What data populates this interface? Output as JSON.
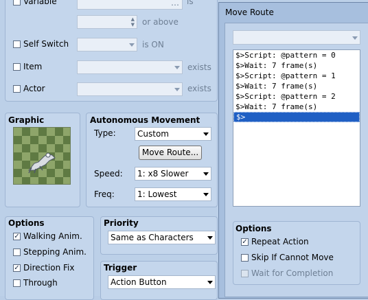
{
  "conditions": {
    "variable_label": "Variable",
    "variable_value": "",
    "variable_suffix": "is",
    "or_above_value": "",
    "or_above_label": "or above",
    "self_switch_label": "Self Switch",
    "self_switch_value": "",
    "self_switch_suffix": "is ON",
    "item_label": "Item",
    "item_value": "",
    "item_suffix": "exists",
    "actor_label": "Actor",
    "actor_value": "",
    "actor_suffix": "exists"
  },
  "graphic": {
    "title": "Graphic"
  },
  "movement": {
    "title": "Autonomous Movement",
    "type_label": "Type:",
    "type_value": "Custom",
    "move_route_button": "Move Route...",
    "speed_label": "Speed:",
    "speed_value": "1: x8 Slower",
    "freq_label": "Freq:",
    "freq_value": "1: Lowest"
  },
  "options": {
    "title": "Options",
    "walking_anim": "Walking Anim.",
    "walking_checked": true,
    "stepping_anim": "Stepping Anim.",
    "stepping_checked": false,
    "direction_fix": "Direction Fix",
    "direction_checked": true,
    "through": "Through",
    "through_checked": false
  },
  "priority": {
    "title": "Priority",
    "value": "Same as Characters"
  },
  "trigger": {
    "title": "Trigger",
    "value": "Action Button"
  },
  "move_route": {
    "title": "Move Route",
    "target_value": "",
    "commands": [
      "$>Script: @pattern = 0",
      "$>Wait: 7 frame(s)",
      "$>Script: @pattern = 1",
      "$>Wait: 7 frame(s)",
      "$>Script: @pattern = 2",
      "$>Wait: 7 frame(s)",
      "$>"
    ],
    "selected_index": 6,
    "options_title": "Options",
    "repeat_action": "Repeat Action",
    "repeat_checked": true,
    "skip_if_cannot_move": "Skip If Cannot Move",
    "skip_checked": false,
    "wait_for_completion": "Wait for Completion",
    "wait_checked": false
  }
}
